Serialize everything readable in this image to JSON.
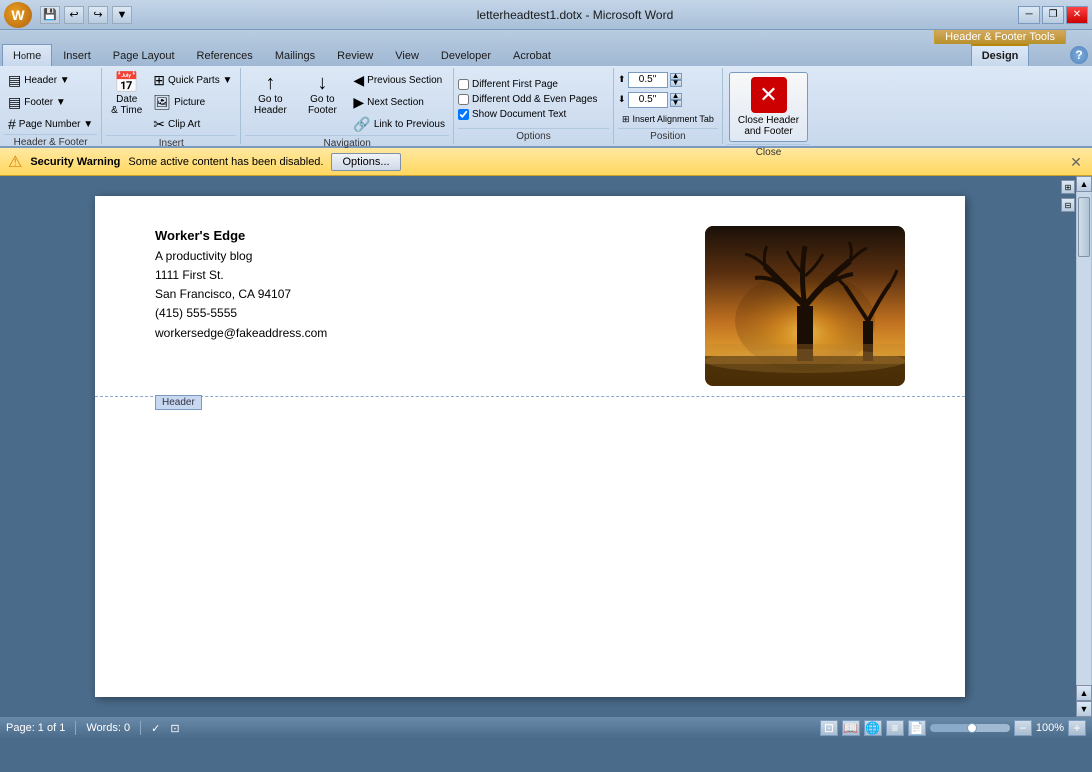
{
  "window": {
    "title": "letterheadtest1.dotx - Microsoft Word",
    "header_footer_tools": "Header & Footer Tools"
  },
  "title_buttons": {
    "minimize": "─",
    "restore": "❐",
    "close": "✕"
  },
  "qat": {
    "buttons": [
      "💾",
      "↩",
      "↪",
      "▼"
    ]
  },
  "ribbon": {
    "tabs": [
      {
        "label": "Home",
        "shortcut": "H"
      },
      {
        "label": "Insert",
        "shortcut": "N"
      },
      {
        "label": "Page Layout",
        "shortcut": "P"
      },
      {
        "label": "References",
        "shortcut": "S"
      },
      {
        "label": "Mailings",
        "shortcut": "M"
      },
      {
        "label": "Review",
        "shortcut": "R"
      },
      {
        "label": "View",
        "shortcut": "W"
      },
      {
        "label": "Developer",
        "shortcut": "L"
      },
      {
        "label": "Acrobat",
        "shortcut": "B"
      },
      {
        "label": "Design",
        "shortcut": "JH",
        "active": true
      }
    ],
    "groups": {
      "header_footer": {
        "label": "Header & Footer",
        "header_btn": "Header ▼",
        "footer_btn": "Footer ▼",
        "page_number_btn": "Page Number ▼"
      },
      "insert": {
        "label": "Insert",
        "date_time": "Date\n& Time",
        "quick_parts": "Quick Parts ▼",
        "picture": "Picture",
        "clip_art": "Clip Art"
      },
      "navigation": {
        "label": "Navigation",
        "goto_header": "Go to\nHeader",
        "goto_footer": "Go to\nFooter",
        "prev_section": "Previous Section",
        "next_section": "Next Section",
        "link_prev": "Link to Previous"
      },
      "options": {
        "label": "Options",
        "diff_first": "Different First Page",
        "diff_odd_even": "Different Odd & Even Pages",
        "show_doc_text": "Show Document Text",
        "show_doc_text_checked": true
      },
      "position": {
        "label": "Position",
        "header_top_label": "0.5\"",
        "footer_bottom_label": "0.5\""
      },
      "close": {
        "label": "Close",
        "close_btn": "Close Header\nand Footer"
      }
    }
  },
  "security_bar": {
    "title": "Security Warning",
    "message": "Some active content has been disabled.",
    "options_btn": "Options..."
  },
  "document": {
    "company_name": "Worker's Edge",
    "tagline": "A productivity blog",
    "address1": "1111 First St.",
    "city_state": "San Francisco, CA 94107",
    "phone": "(415) 555-5555",
    "email": "workersedge@fakeaddress.com",
    "header_label": "Header"
  },
  "status_bar": {
    "page": "Page: 1 of 1",
    "words": "Words: 0",
    "zoom": "100%"
  }
}
